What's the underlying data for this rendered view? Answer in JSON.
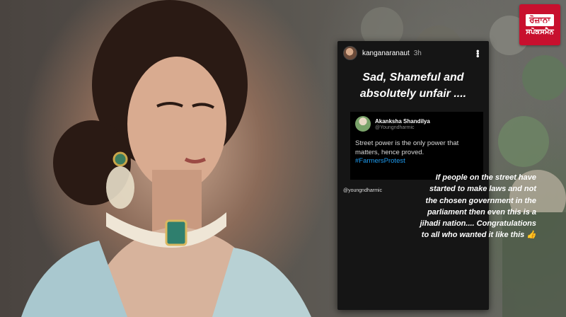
{
  "logo": {
    "top_text": "ਰੋਜ਼ਾਨਾ",
    "bottom_text": "ਸਪੋਕਸਮੈਨ"
  },
  "story": {
    "username": "kanganaranaut",
    "time": "3h",
    "menu_icon": "more-vertical-icon",
    "headline": "Sad, Shameful and absolutely unfair ....",
    "tweet": {
      "name": "Akanksha Shandilya",
      "handle": "@Youngndharmic",
      "body": "Street power is the only power that matters, hence proved.",
      "hashtag": "#FarmersProtest"
    },
    "mention": "@youngndharmic",
    "caption": "If people on the street have started to make laws and not the chosen government in the parliament then even this is a jihadi nation.... Congratulations to all who wanted it like this 👍"
  },
  "colors": {
    "brand_red": "#c8102e",
    "link_blue": "#1d9bf0",
    "story_bg": "#151515"
  }
}
